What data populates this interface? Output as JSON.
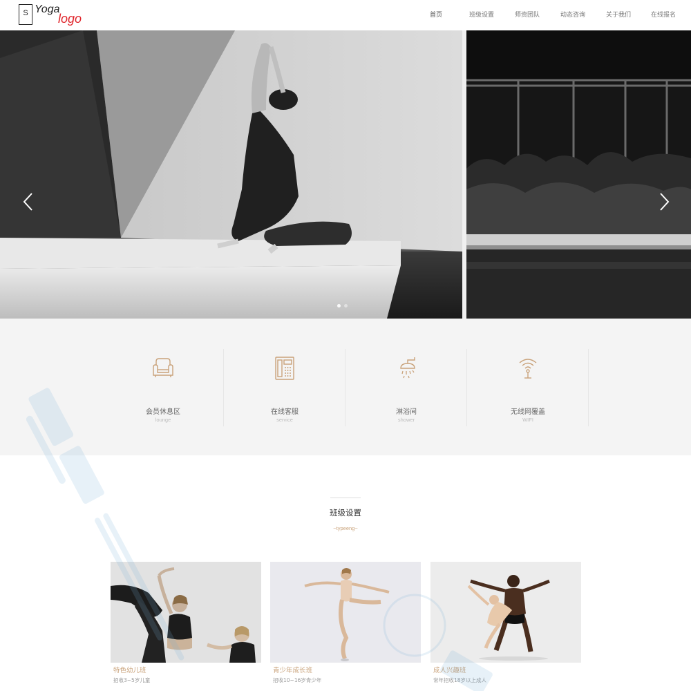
{
  "logo": {
    "letter": "S",
    "word1": "Yoga",
    "word2": "logo"
  },
  "nav": {
    "items": [
      {
        "label": "首页",
        "active": true
      },
      {
        "label": "班级设置",
        "active": false
      },
      {
        "label": "师资团队",
        "active": false
      },
      {
        "label": "动态咨询",
        "active": false
      },
      {
        "label": "关于我们",
        "active": false
      },
      {
        "label": "在线报名",
        "active": false
      }
    ]
  },
  "hero": {
    "prev_icon": "chevron-left-icon",
    "next_icon": "chevron-right-icon",
    "slide_count": 2,
    "active_slide": 1
  },
  "amenities": [
    {
      "icon": "sofa-icon",
      "title": "会员休息区",
      "subtitle": "lounge"
    },
    {
      "icon": "phone-icon",
      "title": "在线客服",
      "subtitle": "service"
    },
    {
      "icon": "shower-icon",
      "title": "淋浴间",
      "subtitle": "shower"
    },
    {
      "icon": "wifi-icon",
      "title": "无线网覆盖",
      "subtitle": "WIFI"
    }
  ],
  "classes_section": {
    "title": "班级设置",
    "subtitle": "~typeeng~",
    "cards": [
      {
        "title": "特色幼儿班",
        "desc": "招收3~5岁儿童"
      },
      {
        "title": "青少年成长班",
        "desc": "招收10~16岁青少年"
      },
      {
        "title": "成人兴趣班",
        "desc": "常年招收18岁以上成人"
      }
    ]
  },
  "colors": {
    "accent": "#c9a27a",
    "logo_red": "#e0252b",
    "amenity_bg": "#f4f4f4",
    "icon_stroke": "#c9a27a"
  }
}
